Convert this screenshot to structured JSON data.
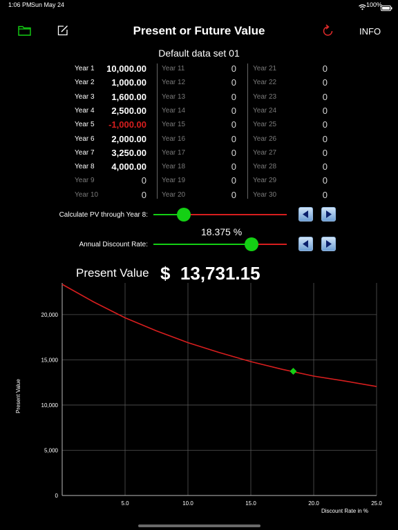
{
  "status_bar": {
    "time": "1:06 PM",
    "date": "Sun May 24",
    "battery": "100%"
  },
  "header": {
    "title": "Present or Future Value",
    "info_label": "INFO",
    "icons": [
      "folder-icon",
      "edit-icon",
      "refresh-icon"
    ]
  },
  "dataset_title": "Default data set 01",
  "years": {
    "col1": [
      {
        "label": "Year 1",
        "value": "10,000.00"
      },
      {
        "label": "Year 2",
        "value": "1,000.00"
      },
      {
        "label": "Year 3",
        "value": "1,600.00"
      },
      {
        "label": "Year 4",
        "value": "2,500.00"
      },
      {
        "label": "Year 5",
        "value": "-1,000.00"
      },
      {
        "label": "Year 6",
        "value": "2,000.00"
      },
      {
        "label": "Year 7",
        "value": "3,250.00"
      },
      {
        "label": "Year 8",
        "value": "4,000.00"
      },
      {
        "label": "Year 9",
        "value": "0"
      },
      {
        "label": "Year 10",
        "value": "0"
      }
    ],
    "col2": [
      {
        "label": "Year 11",
        "value": "0"
      },
      {
        "label": "Year 12",
        "value": "0"
      },
      {
        "label": "Year 13",
        "value": "0"
      },
      {
        "label": "Year 14",
        "value": "0"
      },
      {
        "label": "Year 15",
        "value": "0"
      },
      {
        "label": "Year 16",
        "value": "0"
      },
      {
        "label": "Year 17",
        "value": "0"
      },
      {
        "label": "Year 18",
        "value": "0"
      },
      {
        "label": "Year 19",
        "value": "0"
      },
      {
        "label": "Year 20",
        "value": "0"
      }
    ],
    "col3": [
      {
        "label": "Year 21",
        "value": "0"
      },
      {
        "label": "Year 22",
        "value": "0"
      },
      {
        "label": "Year 23",
        "value": "0"
      },
      {
        "label": "Year 24",
        "value": "0"
      },
      {
        "label": "Year 25",
        "value": "0"
      },
      {
        "label": "Year 26",
        "value": "0"
      },
      {
        "label": "Year 27",
        "value": "0"
      },
      {
        "label": "Year 28",
        "value": "0"
      },
      {
        "label": "Year 29",
        "value": "0"
      },
      {
        "label": "Year 30",
        "value": "0"
      }
    ]
  },
  "controls": {
    "years_slider_label": "Calculate PV through Year 8:",
    "years_slider_level": 0.23,
    "rate_value": "18.375 %",
    "rate_slider_label": "Annual Discount Rate:",
    "rate_slider_level": 0.735
  },
  "result": {
    "label": "Present Value",
    "value": "$  13,731.15"
  },
  "colors": {
    "accent_green": "#14d014",
    "curve_red": "#d81e1e",
    "negative_red": "#d81e1e"
  },
  "chart_data": {
    "type": "line",
    "xlabel": "Discount Rate in %",
    "ylabel": "Present Value",
    "xlim": [
      0,
      25
    ],
    "ylim": [
      0,
      23500
    ],
    "x_ticks": [
      5.0,
      10.0,
      15.0,
      20.0,
      25.0
    ],
    "x_tick_labels": [
      "5.0",
      "10.0",
      "15.0",
      "20.0",
      "25.0"
    ],
    "y_ticks": [
      0,
      5000,
      10000,
      15000,
      20000
    ],
    "y_tick_labels": [
      "0",
      "5,000",
      "10,000",
      "15,000",
      "20,000"
    ],
    "grid": true,
    "series": [
      {
        "x": [
          0,
          2.5,
          5,
          7.5,
          10,
          12.5,
          15,
          17.5,
          20,
          22.5,
          25
        ],
        "y": [
          23350,
          21400,
          19650,
          18200,
          16900,
          15800,
          14800,
          13950,
          13200,
          12650,
          12050
        ]
      }
    ],
    "marker": {
      "x": 18.375,
      "y": 13731.15
    }
  }
}
